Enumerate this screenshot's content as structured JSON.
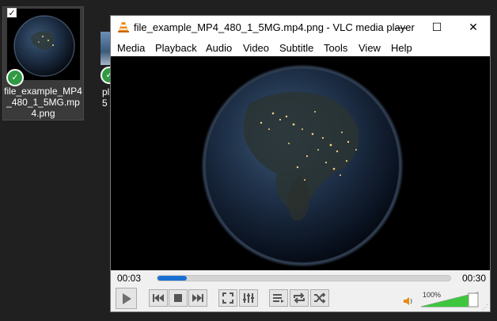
{
  "desktop": {
    "icon1_label": "file_example_MP4_480_1_5MG.mp4.png",
    "icon1_check": "✓",
    "icon2_label": "pl\n5"
  },
  "window": {
    "title": "file_example_MP4_480_1_5MG.mp4.png - VLC media player",
    "controls": {
      "minimize": "—",
      "maximize": "☐",
      "close": "✕"
    },
    "menus": [
      "Media",
      "Playback",
      "Audio",
      "Video",
      "Subtitle",
      "Tools",
      "View",
      "Help"
    ]
  },
  "player": {
    "elapsed": "00:03",
    "total": "00:30",
    "progress_fraction": 0.1,
    "volume_label": "100%",
    "volume_fraction": 1.0
  },
  "colors": {
    "accent": "#1a6fd4",
    "volume": "#3ec63e",
    "badge": "#2f9a43"
  }
}
